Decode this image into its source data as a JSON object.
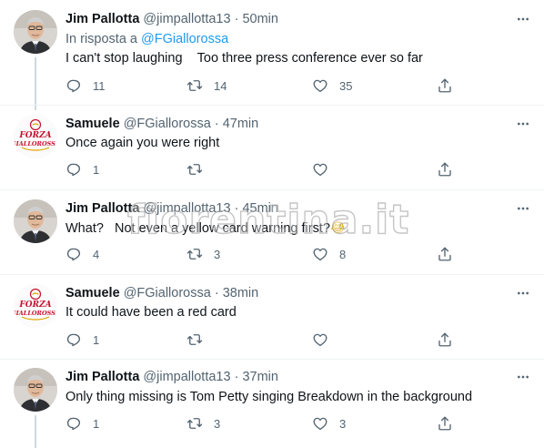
{
  "tweets": [
    {
      "author": "Jim Pallotta",
      "handle": "@jimpallotta13",
      "time": "50min",
      "reply_prefix": "In risposta a",
      "reply_handle": "@FGiallorossa",
      "text": "I can't stop laughing    Too three press conference ever so far",
      "replies": "11",
      "retweets": "14",
      "likes": "35"
    },
    {
      "author": "Samuele",
      "handle": "@FGiallorossa",
      "time": "47min",
      "text": "Once again you were right",
      "replies": "1",
      "retweets": "",
      "likes": ""
    },
    {
      "author": "Jim Pallotta",
      "handle": "@jimpallotta13",
      "time": "45min",
      "text": "What?   Not even a yellow card warning first?",
      "emoji": "😂",
      "replies": "4",
      "retweets": "3",
      "likes": "8"
    },
    {
      "author": "Samuele",
      "handle": "@FGiallorossa",
      "time": "38min",
      "text": "It could have been a red card",
      "replies": "1",
      "retweets": "",
      "likes": ""
    },
    {
      "author": "Jim Pallotta",
      "handle": "@jimpallotta13",
      "time": "37min",
      "text": "Only thing missing is Tom Petty singing Breakdown in the background",
      "replies": "1",
      "retweets": "3",
      "likes": "3"
    }
  ],
  "sep": "·",
  "avatar_logo_text_top": "FORZA",
  "avatar_logo_text_bottom": "GIALLOROSSA",
  "watermark": "fiorentina.it",
  "colors": {
    "text": "#0f1419",
    "secondary": "#536471",
    "link": "#1d9bf0",
    "divider": "#eff3f4",
    "thread_line": "#cfd9de",
    "logo_red": "#c8102e"
  },
  "icons": [
    "reply-icon",
    "retweet-icon",
    "like-icon",
    "share-icon",
    "more-icon"
  ]
}
